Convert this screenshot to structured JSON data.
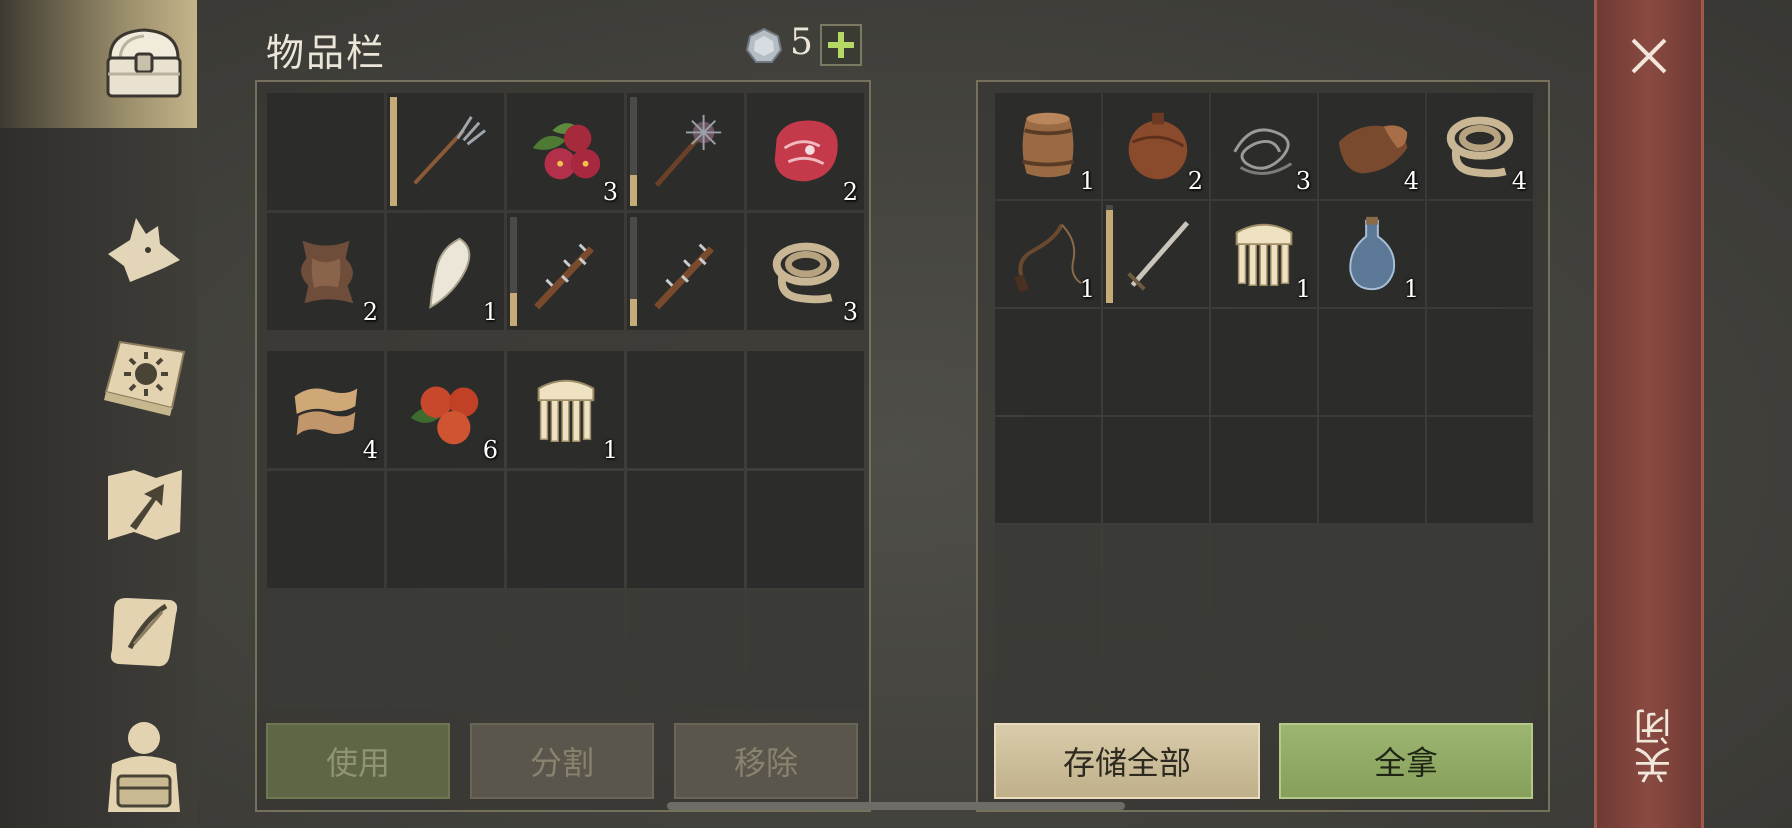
{
  "header": {
    "title": "物品栏",
    "currency": 5,
    "add_label": "+"
  },
  "sidebar": {
    "items": [
      {
        "icon": "chest-icon",
        "active": true
      },
      {
        "icon": "wolf-head-icon",
        "active": false
      },
      {
        "icon": "sun-book-icon",
        "active": false
      },
      {
        "icon": "map-arrow-icon",
        "active": false
      },
      {
        "icon": "scroll-feather-icon",
        "active": false
      },
      {
        "icon": "character-backpack-icon",
        "active": false
      }
    ]
  },
  "inventory": {
    "hotbar": [
      {
        "name": "empty",
        "qty": ""
      },
      {
        "name": "pitchfork",
        "qty": "",
        "durability": 1.0
      },
      {
        "name": "berries",
        "qty": "3"
      },
      {
        "name": "spiked-mace",
        "qty": "",
        "durability": 0.28
      },
      {
        "name": "raw-meat",
        "qty": "2"
      },
      {
        "name": "animal-hide",
        "qty": "2"
      },
      {
        "name": "fang",
        "qty": "1"
      },
      {
        "name": "spiked-club",
        "qty": "",
        "durability": 0.3
      },
      {
        "name": "spiked-club",
        "qty": "",
        "durability": 0.25
      },
      {
        "name": "rope",
        "qty": "3"
      }
    ],
    "backpack": [
      {
        "name": "cloth",
        "qty": "4"
      },
      {
        "name": "apples",
        "qty": "6"
      },
      {
        "name": "comb",
        "qty": "1"
      }
    ],
    "backpack_slots": 15,
    "use_label": "使用",
    "split_label": "分割",
    "remove_label": "移除"
  },
  "storage": {
    "items": [
      {
        "name": "barrel",
        "qty": "1"
      },
      {
        "name": "leather-flask",
        "qty": "2"
      },
      {
        "name": "wire",
        "qty": "3"
      },
      {
        "name": "leather-scrap",
        "qty": "4"
      },
      {
        "name": "rope",
        "qty": "4"
      },
      {
        "name": "whip",
        "qty": "1"
      },
      {
        "name": "sword",
        "qty": "",
        "durability": 0.95
      },
      {
        "name": "comb",
        "qty": "1"
      },
      {
        "name": "glass-bottle",
        "qty": "1"
      }
    ],
    "slots": 30,
    "store_all_label": "存储全部",
    "take_all_label": "全拿"
  },
  "close": {
    "label": "关闭"
  },
  "colors": {
    "accent_gold": "#c4b48a",
    "take_green": "#8fa863",
    "close_red": "#7e4239"
  }
}
